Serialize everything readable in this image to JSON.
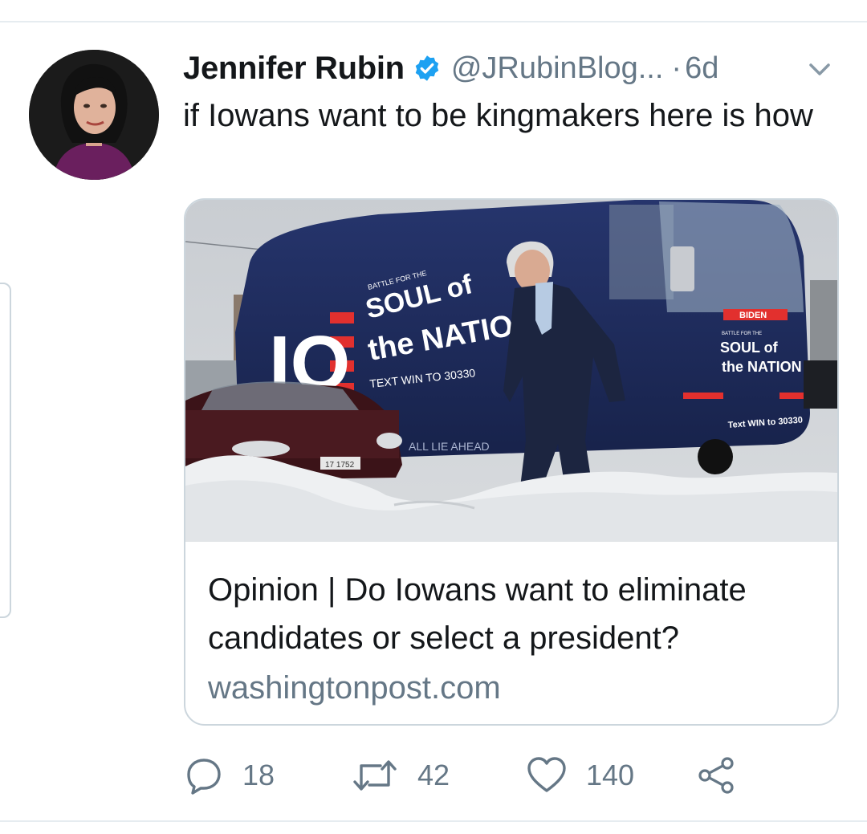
{
  "tweet": {
    "author": {
      "name": "Jennifer Rubin",
      "handle": "@JRubinBlog...",
      "verified": true
    },
    "separator": "·",
    "time": "6d",
    "text": "if Iowans want to be kingmakers here is how",
    "card": {
      "title": "Opinion | Do Iowans want to eliminate candidates or select a president?",
      "domain": "washingtonpost.com",
      "image_texts": {
        "bus_tagline": "BATTLE FOR THE",
        "bus_slogan_1": "SOUL of",
        "bus_slogan_2": "the NATION",
        "bus_text_cta": "TEXT WIN TO 30330",
        "bus_big_mark": "IO",
        "bus_lower": "ALL LIE AHEAD",
        "rear_brand": "BIDEN",
        "rear_tagline": "BATTLE FOR THE",
        "rear_slogan_1": "SOUL of",
        "rear_slogan_2": "the NATION",
        "rear_text_cta": "Text WIN to 30330",
        "plate": "17 1752"
      }
    },
    "actions": {
      "replies": "18",
      "retweets": "42",
      "likes": "140"
    }
  },
  "colors": {
    "text_primary": "#14171a",
    "text_secondary": "#657786",
    "verified_blue": "#1da1f2",
    "border": "#ccd6dd",
    "bus_navy": "#1d2b5e"
  },
  "icons": [
    "verified-badge-icon",
    "chevron-down-icon",
    "reply-icon",
    "retweet-icon",
    "like-icon",
    "share-icon"
  ]
}
